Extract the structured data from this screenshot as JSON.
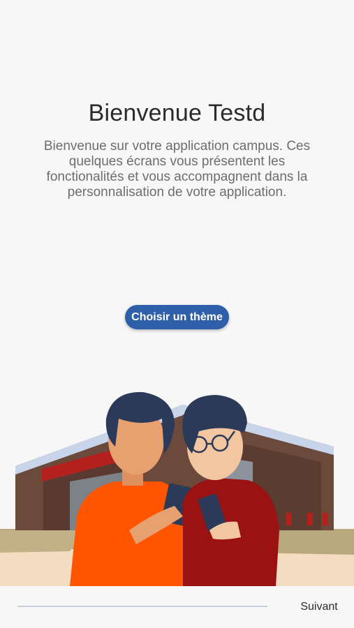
{
  "welcome": {
    "title": "Bienvenue Testd",
    "subtitle": "Bienvenue sur votre application campus. Ces quelques écrans vous présentent les fonctionalités et vous accompagnent dans la personnalisation de votre application.",
    "theme_button_label": "Choisir un thème"
  },
  "footer": {
    "next_label": "Suivant",
    "progress": 0
  },
  "colors": {
    "accent": "#2f5fa8",
    "background": "#f7f7f8"
  }
}
